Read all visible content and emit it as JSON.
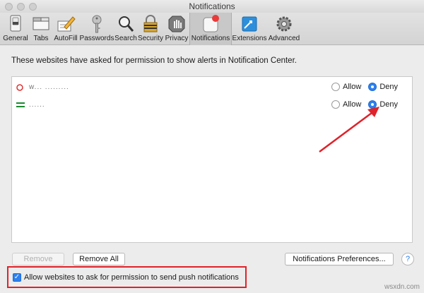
{
  "window": {
    "title": "Notifications"
  },
  "toolbar": {
    "items": [
      {
        "label": "General",
        "icon": "general-switch-icon"
      },
      {
        "label": "Tabs",
        "icon": "tabs-icon"
      },
      {
        "label": "AutoFill",
        "icon": "autofill-pencil-icon"
      },
      {
        "label": "Passwords",
        "icon": "key-icon"
      },
      {
        "label": "Search",
        "icon": "magnifier-icon"
      },
      {
        "label": "Security",
        "icon": "padlock-icon"
      },
      {
        "label": "Privacy",
        "icon": "hand-icon"
      },
      {
        "label": "Notifications",
        "icon": "notifications-badge-icon",
        "selected": true
      },
      {
        "label": "Extensions",
        "icon": "puzzle-icon"
      },
      {
        "label": "Advanced",
        "icon": "gear-icon"
      }
    ]
  },
  "content": {
    "description": "These websites have asked for permission to show alerts in Notification Center.",
    "sites": [
      {
        "name": "w... .........",
        "allow": "Allow",
        "deny": "Deny",
        "selected": "Deny"
      },
      {
        "name": "......",
        "allow": "Allow",
        "deny": "Deny",
        "selected": "Deny"
      }
    ]
  },
  "buttons": {
    "remove": "Remove",
    "remove_all": "Remove All",
    "preferences": "Notifications Preferences...",
    "help": "?"
  },
  "checkbox": {
    "label": "Allow websites to ask for permission to send push notifications",
    "checked": true
  },
  "watermark": "wsxdn.com",
  "colors": {
    "accent": "#2f80ed",
    "highlight": "#e0222a"
  }
}
